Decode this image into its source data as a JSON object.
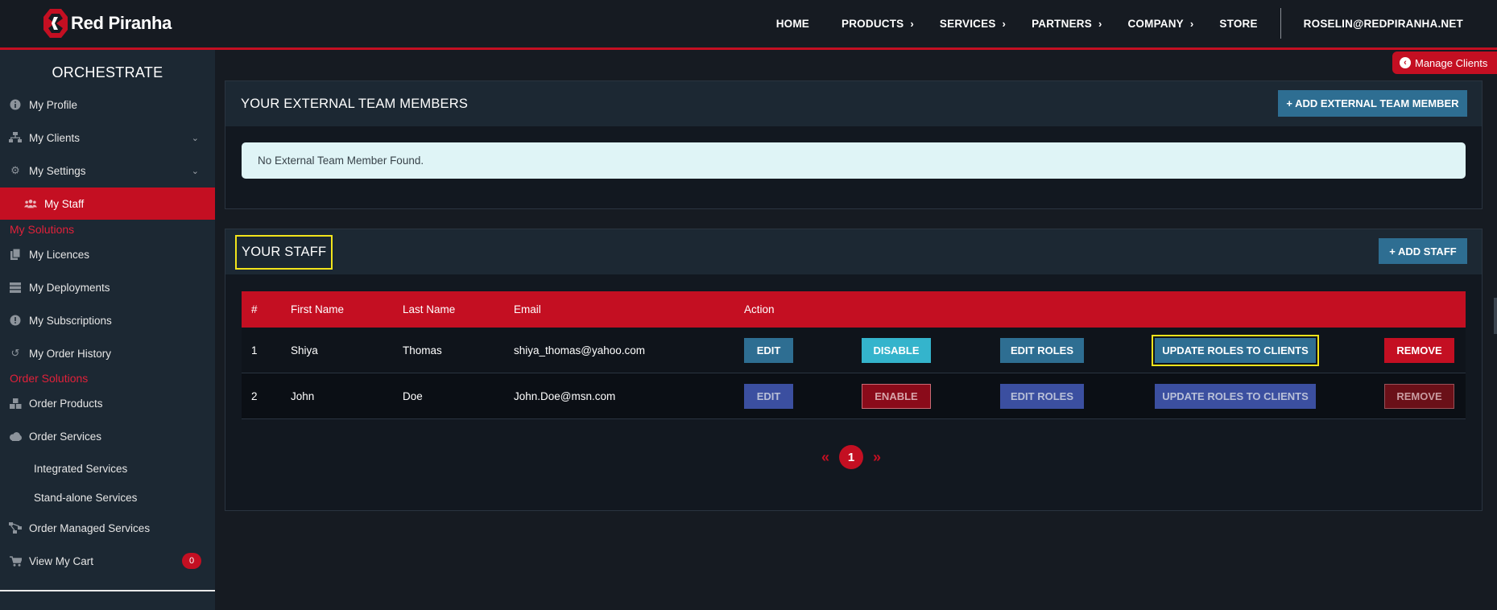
{
  "brand": {
    "name": "Red Piranha"
  },
  "nav": {
    "items": [
      {
        "label": "HOME",
        "has_chevron": false
      },
      {
        "label": "PRODUCTS",
        "has_chevron": true
      },
      {
        "label": "SERVICES",
        "has_chevron": true
      },
      {
        "label": "PARTNERS",
        "has_chevron": true
      },
      {
        "label": "COMPANY",
        "has_chevron": true
      },
      {
        "label": "STORE",
        "has_chevron": false
      }
    ],
    "user_email": "ROSELIN@REDPIRANHA.NET"
  },
  "sidebar": {
    "title": "ORCHESTRATE",
    "items": {
      "my_profile": "My Profile",
      "my_clients": "My Clients",
      "my_settings": "My Settings",
      "my_staff": "My Staff",
      "my_licences": "My Licences",
      "my_deployments": "My Deployments",
      "my_subscriptions": "My Subscriptions",
      "my_order_history": "My Order History",
      "order_products": "Order Products",
      "order_services": "Order Services",
      "integrated_services": "Integrated Services",
      "standalone_services": "Stand-alone Services",
      "order_managed_services": "Order Managed Services",
      "view_my_cart": "View My Cart"
    },
    "headings": {
      "my_solutions": "My Solutions",
      "order_solutions": "Order Solutions"
    },
    "cart_count": "0"
  },
  "manage_clients": {
    "label": "Manage Clients"
  },
  "external_team": {
    "title": "YOUR EXTERNAL TEAM MEMBERS",
    "add_button": "+ ADD EXTERNAL TEAM MEMBER",
    "empty_message": "No External Team Member Found."
  },
  "staff": {
    "title": "YOUR STAFF",
    "add_button": "+ ADD STAFF",
    "columns": {
      "num": "#",
      "first_name": "First Name",
      "last_name": "Last Name",
      "email": "Email",
      "action": "Action"
    },
    "rows": [
      {
        "num": "1",
        "first_name": "Shiya",
        "last_name": "Thomas",
        "email": "shiya_thomas@yahoo.com",
        "edit": "EDIT",
        "toggle": "DISABLE",
        "edit_roles": "EDIT ROLES",
        "update_roles": "UPDATE ROLES TO CLIENTS",
        "remove": "REMOVE"
      },
      {
        "num": "2",
        "first_name": "John",
        "last_name": "Doe",
        "email": "John.Doe@msn.com",
        "edit": "EDIT",
        "toggle": "ENABLE",
        "edit_roles": "EDIT ROLES",
        "update_roles": "UPDATE ROLES TO CLIENTS",
        "remove": "REMOVE"
      }
    ],
    "pagination": {
      "prev": "«",
      "current": "1",
      "next": "»"
    }
  },
  "colors": {
    "brand_red": "#c40f22",
    "button_blue": "#2e6e92",
    "highlight": "#f2e41b"
  }
}
